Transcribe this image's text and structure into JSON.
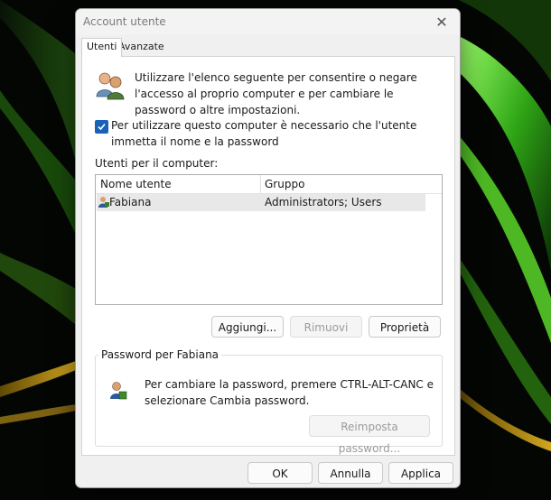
{
  "dialog": {
    "title": "Account utente",
    "close_symbol": "✕"
  },
  "tabs": [
    {
      "label": "Utenti",
      "active": true
    },
    {
      "label": "Avanzate",
      "active": false
    }
  ],
  "users_tab": {
    "intro_text": "Utilizzare l'elenco seguente per consentire o negare l'accesso al proprio computer e per cambiare le password o altre impostazioni.",
    "require_login_checkbox": {
      "label": "Per utilizzare questo computer è necessario che l'utente immetta il nome e la password",
      "checked": true
    },
    "users_list_label": "Utenti per il computer:",
    "columns": [
      "Nome utente",
      "Gruppo"
    ],
    "rows": [
      {
        "name": "Fabiana",
        "group": "Administrators; Users"
      }
    ],
    "buttons": {
      "add": "Aggiungi...",
      "remove": "Rimuovi",
      "properties": "Proprietà"
    },
    "password_group": {
      "title": "Password per Fabiana",
      "text": "Per cambiare la password, premere CTRL-ALT-CANC e selezionare Cambia password.",
      "reset_button": "Reimposta password..."
    }
  },
  "footer": {
    "ok": "OK",
    "cancel": "Annulla",
    "apply": "Applica"
  },
  "colors": {
    "accent": "#1a62b8",
    "desktop_green": "#3fbf1f",
    "desktop_gold": "#c8a21a"
  }
}
